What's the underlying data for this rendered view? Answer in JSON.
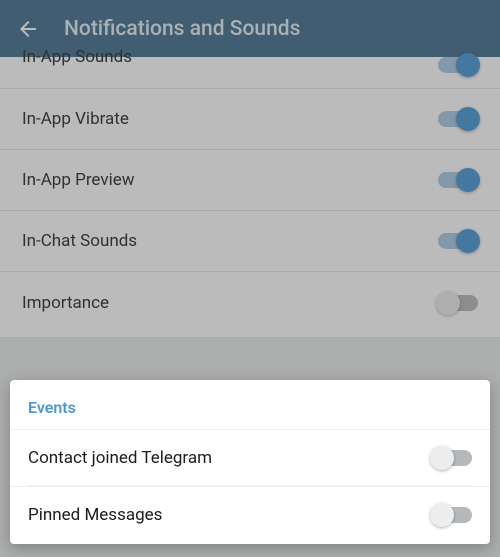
{
  "header": {
    "title": "Notifications and Sounds"
  },
  "bg_rows": [
    {
      "label": "In-App Sounds",
      "state": "on"
    },
    {
      "label": "In-App Vibrate",
      "state": "on"
    },
    {
      "label": "In-App Preview",
      "state": "on"
    },
    {
      "label": "In-Chat Sounds",
      "state": "on"
    },
    {
      "label": "Importance",
      "state": "off"
    }
  ],
  "card": {
    "section_title": "Events",
    "rows": [
      {
        "label": "Contact joined Telegram",
        "state": "off"
      },
      {
        "label": "Pinned Messages",
        "state": "off"
      }
    ]
  }
}
